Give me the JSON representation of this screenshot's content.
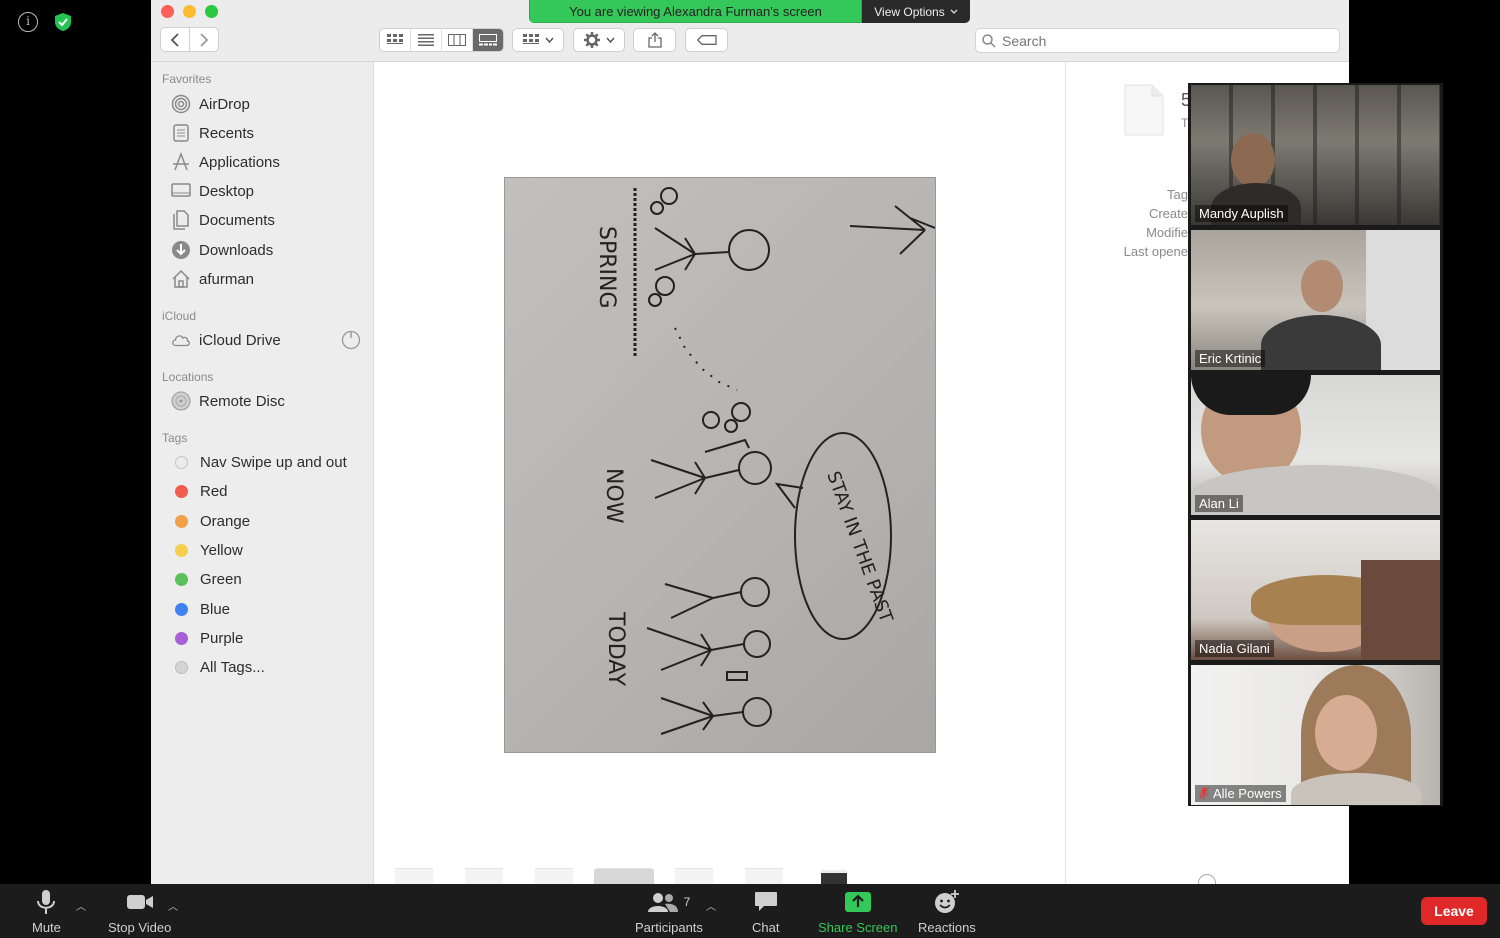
{
  "banner": {
    "message": "You are viewing Alexandra Furman's screen",
    "options_label": "View Options"
  },
  "finder": {
    "search_placeholder": "Search",
    "sidebar": {
      "favorites_heading": "Favorites",
      "favorites": [
        {
          "label": "AirDrop",
          "icon": "airdrop-icon"
        },
        {
          "label": "Recents",
          "icon": "recents-icon"
        },
        {
          "label": "Applications",
          "icon": "applications-icon"
        },
        {
          "label": "Desktop",
          "icon": "desktop-icon"
        },
        {
          "label": "Documents",
          "icon": "documents-icon"
        },
        {
          "label": "Downloads",
          "icon": "downloads-icon"
        },
        {
          "label": "afurman",
          "icon": "home-icon"
        }
      ],
      "icloud_heading": "iCloud",
      "icloud": [
        {
          "label": "iCloud Drive",
          "icon": "icloud-icon"
        }
      ],
      "locations_heading": "Locations",
      "locations": [
        {
          "label": "Remote Disc",
          "icon": "disc-icon"
        }
      ],
      "tags_heading": "Tags",
      "tags": [
        {
          "label": "Nav Swipe up and out",
          "color": "#d9d9d9"
        },
        {
          "label": "Red",
          "color": "#f15b50"
        },
        {
          "label": "Orange",
          "color": "#f0a046"
        },
        {
          "label": "Yellow",
          "color": "#f5cf4d"
        },
        {
          "label": "Green",
          "color": "#5ac05a"
        },
        {
          "label": "Blue",
          "color": "#3f82f0"
        },
        {
          "label": "Purple",
          "color": "#a65fd6"
        },
        {
          "label": "All Tags...",
          "color": "#d4d4d4"
        }
      ]
    },
    "preview_text": {
      "spring": "SPRING",
      "now": "NOW",
      "today": "TODAY",
      "bubble": "STAY IN THE PAST"
    },
    "info": {
      "size_partial": "5",
      "kind_partial": "T",
      "tags_label": "Tag",
      "created_label": "Create",
      "modified_label": "Modifie",
      "opened_label": "Last opene"
    }
  },
  "participants": [
    {
      "name": "Mandy Auplish",
      "muted": false
    },
    {
      "name": "Eric Krtinic",
      "muted": false
    },
    {
      "name": "Alan Li",
      "muted": false
    },
    {
      "name": "Nadia Gilani",
      "muted": false
    },
    {
      "name": "Alle Powers",
      "muted": true
    }
  ],
  "toolbar": {
    "mute": "Mute",
    "stop_video": "Stop Video",
    "participants": "Participants",
    "participants_count": "7",
    "chat": "Chat",
    "share_screen": "Share Screen",
    "reactions": "Reactions",
    "leave": "Leave"
  },
  "colors": {
    "share_green": "#34c759",
    "leave_red": "#e02828"
  }
}
